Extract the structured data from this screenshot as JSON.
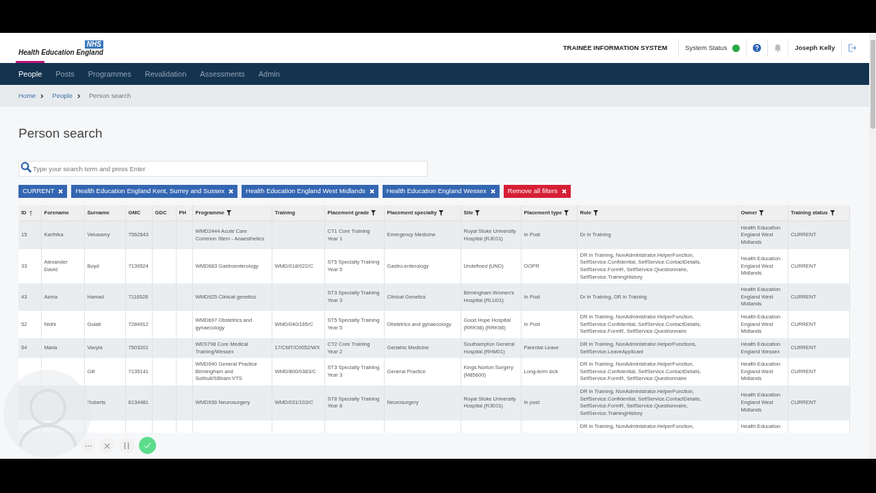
{
  "logo": {
    "badge": "NHS",
    "text": "Health Education England"
  },
  "header": {
    "system_name": "TRAINEE INFORMATION SYSTEM",
    "status_label": "System Status",
    "user": "Joseph Kelly"
  },
  "nav": [
    {
      "label": "People",
      "selected": true
    },
    {
      "label": "Posts",
      "selected": false
    },
    {
      "label": "Programmes",
      "selected": false
    },
    {
      "label": "Revalidation",
      "selected": false
    },
    {
      "label": "Assessments",
      "selected": false
    },
    {
      "label": "Admin",
      "selected": false
    }
  ],
  "breadcrumb": [
    {
      "label": "Home",
      "current": false
    },
    {
      "label": "People",
      "current": false
    },
    {
      "label": "Person search",
      "current": true
    }
  ],
  "title": "Person search",
  "search": {
    "placeholder": "Type your search term and press Enter"
  },
  "filters": [
    {
      "label": "CURRENT",
      "kind": "filter"
    },
    {
      "label": "Health Education England Kent, Surrey and Sussex",
      "kind": "filter"
    },
    {
      "label": "Health Education England West Midlands",
      "kind": "filter"
    },
    {
      "label": "Health Education England Wessex",
      "kind": "filter"
    },
    {
      "label": "Remove all filters",
      "kind": "clear"
    }
  ],
  "table": {
    "columns": [
      {
        "label": "ID",
        "sorted_ascending": true,
        "filter": false
      },
      {
        "label": "Forename",
        "filter": false
      },
      {
        "label": "Surname",
        "filter": false
      },
      {
        "label": "GMC",
        "filter": false
      },
      {
        "label": "GDC",
        "filter": false
      },
      {
        "label": "PH",
        "filter": false
      },
      {
        "label": "Programme",
        "filter": true
      },
      {
        "label": "Training",
        "filter": false
      },
      {
        "label": "Placement grade",
        "filter": true
      },
      {
        "label": "Placement specialty",
        "filter": true
      },
      {
        "label": "Site",
        "filter": true
      },
      {
        "label": "Placement type",
        "filter": true
      },
      {
        "label": "Role",
        "filter": true
      },
      {
        "label": "Owner",
        "filter": true
      },
      {
        "label": "Training status",
        "filter": true
      }
    ],
    "rows": [
      {
        "id": "15",
        "forename": "Karthika",
        "surname": "Velusamy",
        "gmc": "7562643",
        "programme": "WMD2444 Acute Care Common Stem - Anaesthetics",
        "placement_grade": "CT1 Core Training Year 1",
        "placement_specialty": "Emergency Medicine",
        "site": "Royal Stoke University Hospital (RJE01)",
        "placement_type": "In Post",
        "role": "Dr in Training",
        "owner": "Health Education England West Midlands",
        "training_status": "CURRENT"
      },
      {
        "id": "33",
        "forename": "Alexander David",
        "surname": "Boyd",
        "gmc": "7139524",
        "programme": "WMD683 Gastroenterology",
        "training": "WMD/018/022/C",
        "placement_grade": "ST5 Specialty Training Year 5",
        "placement_specialty": "Gastro-enterology",
        "site": "Undefined (UND)",
        "placement_type": "OOPR",
        "role": "DR in Training, NonAdministrator.HelperFunction, SelfService.Confidential, SelfService.ContactDetails, SelfService.FormR, SelfService.Questionnaire, SelfService.TrainingHistory",
        "owner": "Health Education England West Midlands",
        "training_status": "CURRENT"
      },
      {
        "id": "43",
        "forename": "Asma",
        "surname": "Hamad",
        "gmc": "7116526",
        "programme": "WMD925 Clinical genetics",
        "placement_grade": "ST3 Specialty Training Year 3",
        "placement_specialty": "Clinical Genetics",
        "site": "Birmingham Women's Hospital (RLU01)",
        "placement_type": "In Post",
        "role": "Dr in Training, DR in Training",
        "owner": "Health Education England West Midlands",
        "training_status": "CURRENT"
      },
      {
        "id": "52",
        "forename": "Nidhi",
        "surname": "Gulati",
        "gmc": "7284912",
        "programme": "WMD697 Obstetrics and gynaecology",
        "training": "WMD/040/165/C",
        "placement_grade": "ST5 Specialty Training Year 5",
        "placement_specialty": "Obstetrics and gynaecology",
        "site": "Good Hope Hospital (RRK98) (RRK98)",
        "placement_type": "In Post",
        "role": "DR in Training, NonAdministrator.HelperFunction, SelfService.Confidential, SelfService.ContactDetails, SelfService.FormR, SelfService.Questionnaire",
        "owner": "Health Education England West Midlands",
        "training_status": "CURRENT"
      },
      {
        "id": "54",
        "forename": "Maria",
        "surname": "Vavyla",
        "gmc": "7503201",
        "programme": "WES798 Core Medical Training/Wessex",
        "training": "17/CMT/C0052/WX",
        "placement_grade": "CT2 Core Training Year 2",
        "placement_specialty": "Geriatric Medicine",
        "site": "Southampton General Hospital (RHM01)",
        "placement_type": "Parental Leave",
        "role": "DR in Training, NonAdministrator.HelperFunctions, SelfService.LeaveApplicant",
        "owner": "Health Education England Wessex",
        "training_status": "CURRENT"
      },
      {
        "surname": "Gill",
        "gmc": "7135141",
        "programme": "WMD940 General Practice Birmingham and Solihull/SBham VTS",
        "training": "WMD/800/0383/C",
        "placement_grade": "ST3 Specialty Training Year 3",
        "placement_specialty": "General Practice",
        "site": "Kings Norton Surgery (M85600)",
        "placement_type": "Long-term sick",
        "role": "DR in Training, NonAdministrator.HelperFunction, SelfService.Confidential, SelfService.ContactDetails, SelfService.FormR, SelfService.Questionnaire",
        "owner": "Health Education England West Midlands",
        "training_status": "CURRENT"
      },
      {
        "surname": "Roberts",
        "gmc": "6134481",
        "programme": "WMD936 Neurosurgery",
        "training": "WMD/031/103/C",
        "placement_grade": "ST8 Specialty Training Year 8",
        "placement_specialty": "Neurosurgery",
        "site": "Royal Stoke University Hospital (RJE01)",
        "placement_type": "In post",
        "role": "DR in Training, NonAdministrator.HelperFunction, SelfService.Confidential, SelfService.ContactDetails, SelfService.FormR, SelfService.Questionnaire, SelfService.TrainingHistory",
        "owner": "Health Education England West Midlands",
        "training_status": "CURRENT"
      },
      {
        "role": "DR in Training, NonAdministrator.HelperFunction,",
        "owner": "Health Education"
      }
    ]
  },
  "recorder": {
    "paused": false
  }
}
